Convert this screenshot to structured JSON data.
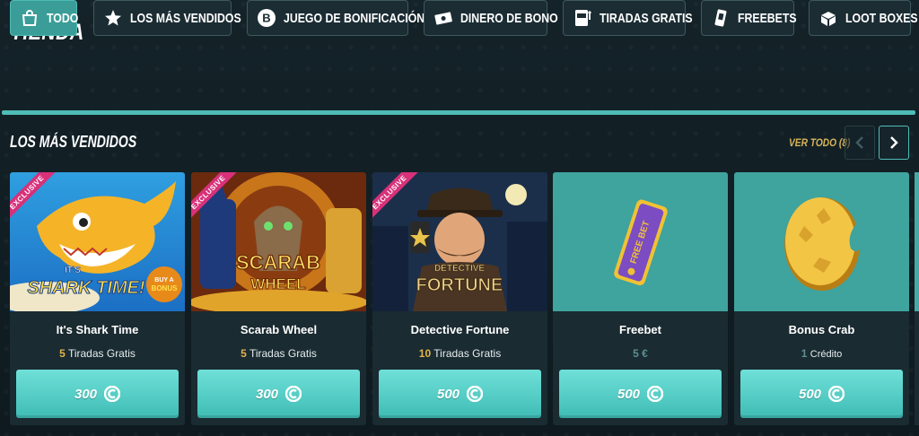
{
  "page": {
    "title": "TIENDA"
  },
  "tabs": [
    {
      "label": "TODO",
      "icon": "shopping-bag-icon",
      "active": true
    },
    {
      "label": "LOS MÁS VENDIDOS",
      "icon": "star-icon",
      "active": false
    },
    {
      "label": "JUEGO DE BONIFICACIÓN",
      "icon": "bonus-b-icon",
      "active": false
    },
    {
      "label": "DINERO DE BONO",
      "icon": "banknote-icon",
      "active": false
    },
    {
      "label": "TIRADAS GRATIS",
      "icon": "slot-machine-icon",
      "active": false
    },
    {
      "label": "FREEBETS",
      "icon": "ticket-icon",
      "active": false
    },
    {
      "label": "LOOT BOXES",
      "icon": "box-icon",
      "active": false
    }
  ],
  "section": {
    "title": "LOS MÁS VENDIDOS",
    "see_all": "VER TODO (8)"
  },
  "cards": [
    {
      "name": "It's Shark Time",
      "reward_amount": "5",
      "reward_unit": "Tiradas Gratis",
      "price": "300",
      "exclusive": true,
      "exclusive_label": "EXCLUSIVE",
      "image_text": [
        "IT'S",
        "SHARK TIME!",
        "BUY A",
        "BONUS"
      ]
    },
    {
      "name": "Scarab Wheel",
      "reward_amount": "5",
      "reward_unit": "Tiradas Gratis",
      "price": "300",
      "exclusive": true,
      "exclusive_label": "EXCLUSIVE",
      "image_text": [
        "SCARAB",
        "WHEEL"
      ]
    },
    {
      "name": "Detective Fortune",
      "reward_amount": "10",
      "reward_unit": "Tiradas Gratis",
      "price": "500",
      "exclusive": true,
      "exclusive_label": "EXCLUSIVE",
      "image_text": [
        "DETECTIVE",
        "FORTUNE"
      ]
    },
    {
      "name": "Freebet",
      "reward_amount": "5 €",
      "reward_unit": "",
      "price": "500",
      "exclusive": false,
      "image_text": [
        "FREE BET"
      ]
    },
    {
      "name": "Bonus Crab",
      "reward_amount": "1",
      "reward_unit": "Crédito",
      "price": "500",
      "exclusive": false,
      "image_text": []
    }
  ],
  "colors": {
    "accent": "#4fbcb6",
    "price_button": "#5ad2ca",
    "gold": "#e3b24c",
    "exclusive": "#d8317a",
    "background": "#0f1c22"
  }
}
